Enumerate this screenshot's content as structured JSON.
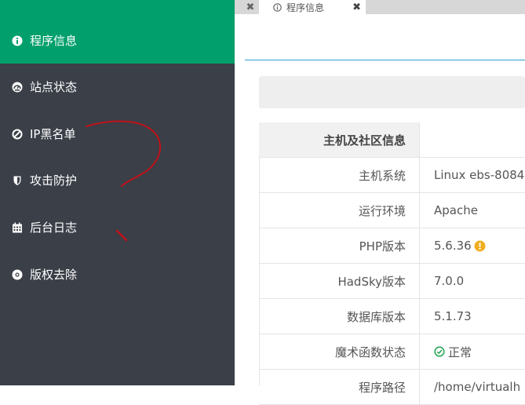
{
  "sidebar": {
    "items": [
      {
        "label": "程序信息",
        "icon": "info-circle-icon",
        "active": true
      },
      {
        "label": "站点状态",
        "icon": "dashboard-icon",
        "active": false
      },
      {
        "label": "IP黑名单",
        "icon": "ban-icon",
        "active": false
      },
      {
        "label": "攻击防护",
        "icon": "shield-icon",
        "active": false
      },
      {
        "label": "后台日志",
        "icon": "calendar-icon",
        "active": false
      },
      {
        "label": "版权去除",
        "icon": "life-ring-icon",
        "active": false
      }
    ]
  },
  "tabs": {
    "active_label": "程序信息",
    "close_symbol": "✖"
  },
  "table": {
    "header": "主机及社区信息",
    "rows": [
      {
        "key": "主机系统",
        "value": "Linux ebs-8084"
      },
      {
        "key": "运行环境",
        "value": "Apache"
      },
      {
        "key": "PHP版本",
        "value": "5.6.36",
        "status": "warning"
      },
      {
        "key": "HadSky版本",
        "value": "7.0.0"
      },
      {
        "key": "数据库版本",
        "value": "5.1.73"
      },
      {
        "key": "魔术函数状态",
        "value": "正常",
        "status": "ok"
      },
      {
        "key": "程序路径",
        "value": "/home/virtualh"
      }
    ]
  },
  "colors": {
    "accent": "#009f6b",
    "sidebar_bg": "#3a3f48",
    "warning": "#f0ad1e",
    "ok": "#2ca85a",
    "scribble": "#c0121a"
  }
}
